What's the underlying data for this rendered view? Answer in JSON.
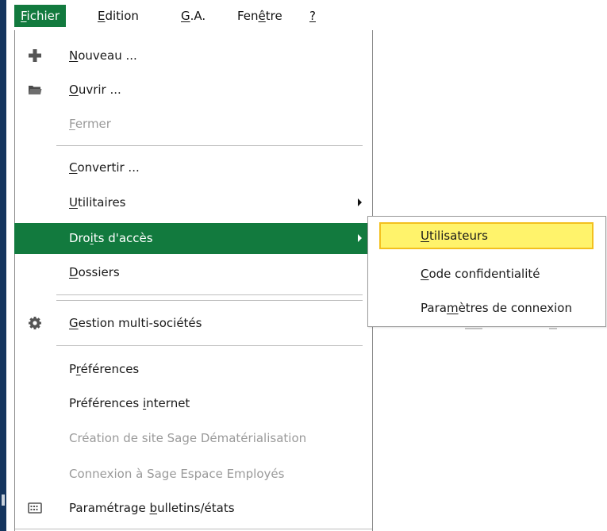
{
  "menubar": {
    "items": [
      {
        "id": "fichier",
        "label": "Fichier",
        "ul_index": 0,
        "active": true
      },
      {
        "id": "edition",
        "label": "Edition",
        "ul_index": 0,
        "active": false
      },
      {
        "id": "ga",
        "label": "G.A.",
        "ul_index": 0,
        "active": false
      },
      {
        "id": "fenetre",
        "label": "Fenêtre",
        "ul_index": 3,
        "active": false
      },
      {
        "id": "help",
        "label": "?",
        "ul_index": 0,
        "active": false
      }
    ]
  },
  "fichier_menu": {
    "items": [
      {
        "id": "nouveau",
        "label": "Nouveau ...",
        "ul_index": 0,
        "icon": "plus-icon",
        "state": "normal"
      },
      {
        "id": "ouvrir",
        "label": "Ouvrir ...",
        "ul_index": 0,
        "icon": "folder-icon",
        "state": "normal"
      },
      {
        "id": "fermer",
        "label": "Fermer",
        "ul_index": 0,
        "icon": "",
        "state": "disabled"
      },
      {
        "id": "convertir",
        "label": "Convertir ...",
        "ul_index": 0,
        "icon": "",
        "state": "normal"
      },
      {
        "id": "utilitaires",
        "label": "Utilitaires",
        "ul_index": 0,
        "icon": "",
        "state": "normal",
        "submenu": true
      },
      {
        "id": "droits-acces",
        "label": "Droits d'accès",
        "ul_index": 3,
        "icon": "",
        "state": "highlighted",
        "submenu": true
      },
      {
        "id": "dossiers",
        "label": "Dossiers",
        "ul_index": 0,
        "icon": "",
        "state": "normal"
      },
      {
        "id": "gestion-multi-societes",
        "label": "Gestion multi-sociétés",
        "ul_index": 0,
        "icon": "gear-icon",
        "state": "normal"
      },
      {
        "id": "preferences",
        "label": "Préférences",
        "ul_index": 1,
        "icon": "",
        "state": "normal"
      },
      {
        "id": "preferences-internet",
        "label": "Préférences internet",
        "ul_index": 12,
        "icon": "",
        "state": "normal"
      },
      {
        "id": "creation-site",
        "label": "Création de site Sage Dématérialisation",
        "ul_index": -1,
        "icon": "",
        "state": "disabled"
      },
      {
        "id": "connexion-espace",
        "label": "Connexion à Sage Espace Employés",
        "ul_index": -1,
        "icon": "",
        "state": "disabled"
      },
      {
        "id": "parametrage-bulletins",
        "label": "Paramétrage bulletins/états",
        "ul_index": 12,
        "icon": "keyboard-icon",
        "state": "normal"
      }
    ]
  },
  "droits_submenu": {
    "items": [
      {
        "id": "utilisateurs",
        "label": "Utilisateurs",
        "ul_index": 0,
        "state": "hover"
      },
      {
        "id": "code-confidentialite",
        "label": "Code confidentialité",
        "ul_index": 0,
        "state": "normal"
      },
      {
        "id": "parametres-connexion",
        "label": "Paramètres de connexion",
        "ul_index": 4,
        "state": "normal"
      }
    ]
  },
  "colors": {
    "highlight_green": "#127a3e",
    "hover_yellow": "#fff36b",
    "hover_border": "#f3c01e",
    "disabled_text": "#9a9a9a",
    "window_edge": "#14355e"
  }
}
